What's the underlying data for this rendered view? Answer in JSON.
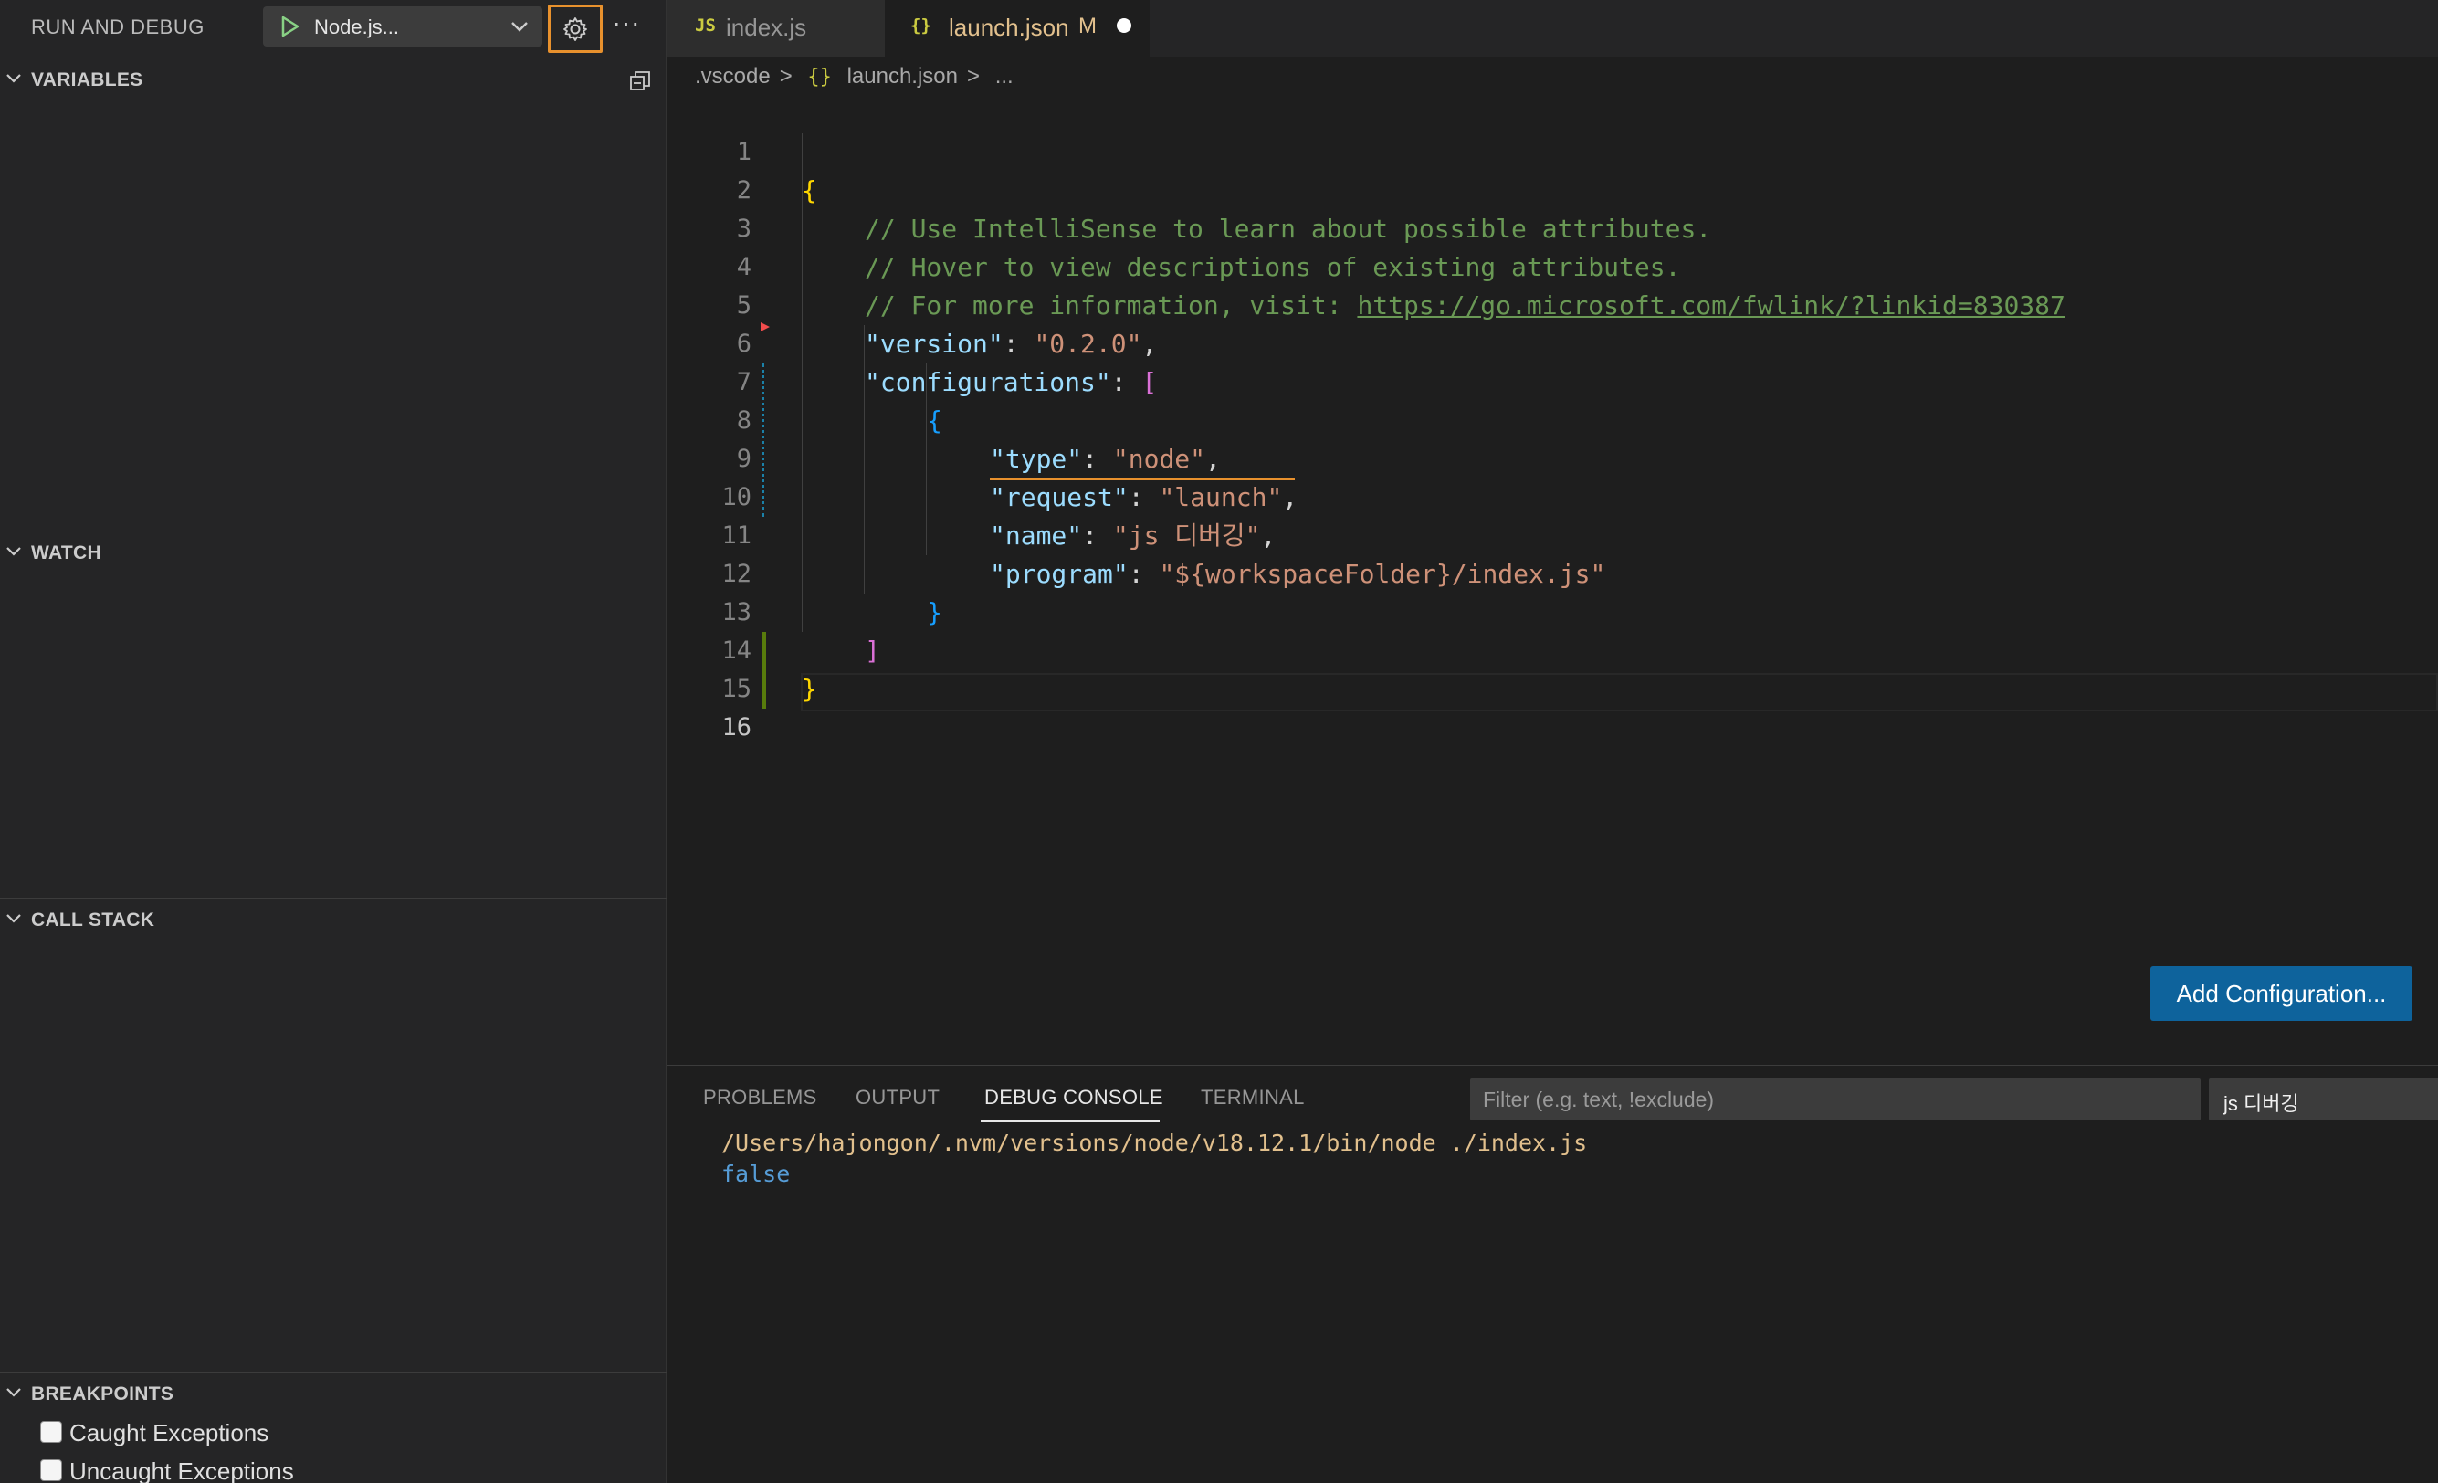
{
  "sidebar": {
    "title": "RUN AND DEBUG",
    "config_selected": "Node.js...",
    "more_label": "···",
    "sections": {
      "variables": "VARIABLES",
      "watch": "WATCH",
      "call_stack": "CALL STACK",
      "breakpoints": "BREAKPOINTS"
    },
    "breakpoints": [
      {
        "label": "Caught Exceptions",
        "checked": false
      },
      {
        "label": "Uncaught Exceptions",
        "checked": false
      }
    ]
  },
  "tabs": [
    {
      "icon": "JS",
      "label": "index.js"
    },
    {
      "icon": "{}",
      "label": "launch.json",
      "status": "M"
    }
  ],
  "breadcrumb": {
    "folder": ".vscode",
    "sep": ">",
    "file_icon": "{}",
    "file": "launch.json",
    "rest": "..."
  },
  "editor": {
    "lines": [
      {
        "n": "1"
      },
      {
        "n": "2"
      },
      {
        "n": "3"
      },
      {
        "n": "4"
      },
      {
        "n": "5"
      },
      {
        "n": "6"
      },
      {
        "n": "7"
      },
      {
        "n": "8"
      },
      {
        "n": "9"
      },
      {
        "n": "10"
      },
      {
        "n": "11"
      },
      {
        "n": "12"
      },
      {
        "n": "13"
      },
      {
        "n": "14"
      },
      {
        "n": "15"
      },
      {
        "n": "16"
      }
    ],
    "code": {
      "l1": "{",
      "l2": "// Use IntelliSense to learn about possible attributes.",
      "l3": "// Hover to view descriptions of existing attributes.",
      "l4_comment": "// For more information, visit: ",
      "l4_link": "https://go.microsoft.com/fwlink/?linkid=830387",
      "l5_key": "\"version\"",
      "l5_val": "\"0.2.0\"",
      "l6_key": "\"configurations\"",
      "l6_open": "[",
      "l7": "{",
      "l8_key": "\"type\"",
      "l8_val": "\"node\"",
      "l9_key": "\"request\"",
      "l9_val": "\"launch\"",
      "l10_key": "\"name\"",
      "l10_val": "\"js 디버깅\"",
      "l11_key": "\"program\"",
      "l11_val": "\"${workspaceFolder}/index.js\"",
      "l12": "}",
      "l13": "]",
      "l14": "}",
      "colon": ": ",
      "comma": ","
    },
    "add_config_label": "Add Configuration..."
  },
  "panel": {
    "tabs": [
      "PROBLEMS",
      "OUTPUT",
      "DEBUG CONSOLE",
      "TERMINAL"
    ],
    "active_tab": "DEBUG CONSOLE",
    "filter_placeholder": "Filter (e.g. text, !exclude)",
    "session": "js 디버깅",
    "console_lines": [
      "/Users/hajongon/.nvm/versions/node/v18.12.1/bin/node ./index.js",
      "false"
    ]
  },
  "colors": {
    "accent_focus": "#e8912d",
    "button_primary": "#0e639c",
    "modified_git_bar": "#587c0c"
  }
}
